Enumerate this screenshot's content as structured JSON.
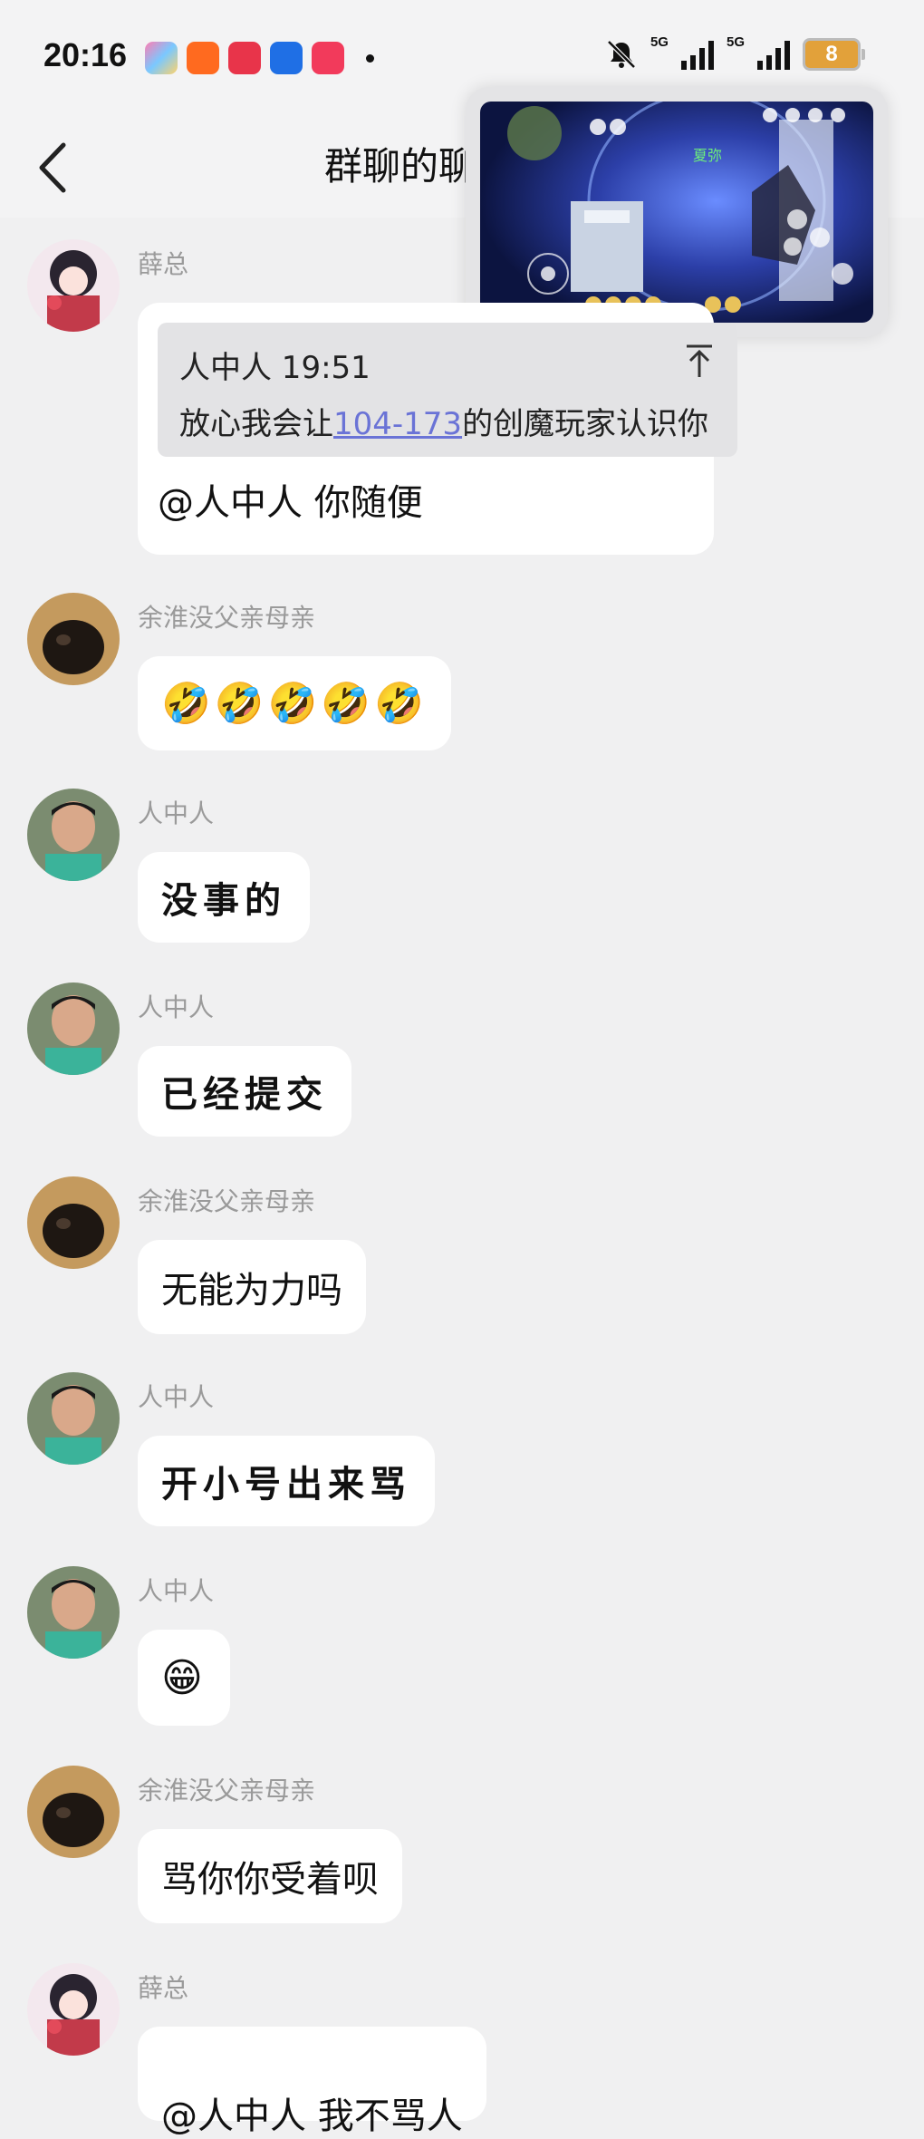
{
  "status_bar": {
    "time": "20:16",
    "network_1": "5G",
    "network_2": "5G",
    "battery": "8"
  },
  "header": {
    "title": "群聊的聊"
  },
  "messages": [
    {
      "sender": "薛总",
      "quote_author_time": "人中人 19:51",
      "quote_prefix": "放心我会让",
      "quote_link": "104-173",
      "quote_suffix": "的创魔玩家认识你",
      "text": "@人中人 你随便"
    },
    {
      "sender": "余淮没父亲母亲",
      "text": "🤣🤣🤣🤣🤣"
    },
    {
      "sender": "人中人",
      "text": "没事的"
    },
    {
      "sender": "人中人",
      "text": "已经提交"
    },
    {
      "sender": "余淮没父亲母亲",
      "text": "无能为力吗"
    },
    {
      "sender": "人中人",
      "text": "开小号出来骂"
    },
    {
      "sender": "人中人",
      "text": "😁"
    },
    {
      "sender": "余淮没父亲母亲",
      "text": "骂你你受着呗"
    },
    {
      "sender": "薛总",
      "text": "@人中人 我不骂人"
    }
  ],
  "pip_overlay": {
    "game_label": "夏弥"
  },
  "colors": {
    "background": "#f0f0f1",
    "bubble": "#ffffff",
    "link": "#6a73d6",
    "sender_name": "#9a9a9a"
  }
}
